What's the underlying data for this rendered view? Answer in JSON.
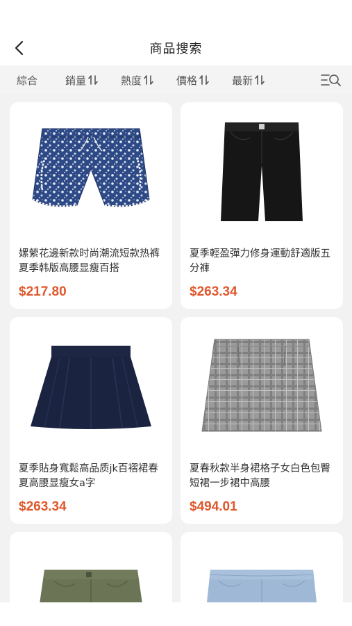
{
  "header": {
    "title": "商品搜索"
  },
  "sort_bar": {
    "items": [
      "綜合",
      "銷量",
      "熱度",
      "價格",
      "最新"
    ]
  },
  "products": [
    {
      "title": "嫘縈花邊新款时尚潮流短款热裤夏季韩版高腰显瘦百搭",
      "price": "$217.80",
      "image": "floral-shorts"
    },
    {
      "title": "夏季輕盈彈力修身運動舒適版五分褲",
      "price": "$263.34",
      "image": "black-bermuda-shorts"
    },
    {
      "title": "夏季貼身寬鬆高品质jk百褶裙春夏高腰显瘦女a字",
      "price": "$263.34",
      "image": "navy-pleated-skirt"
    },
    {
      "title": "夏春秋款半身裙格子女白色包臀短裙一步裙中高腰",
      "price": "$494.01",
      "image": "plaid-pencil-skirt"
    },
    {
      "title": "",
      "price": "",
      "image": "olive-cargo-shorts"
    },
    {
      "title": "",
      "price": "",
      "image": "light-denim-shorts"
    }
  ],
  "colors": {
    "accent": "#e0582c",
    "background": "#f2f2f2"
  }
}
